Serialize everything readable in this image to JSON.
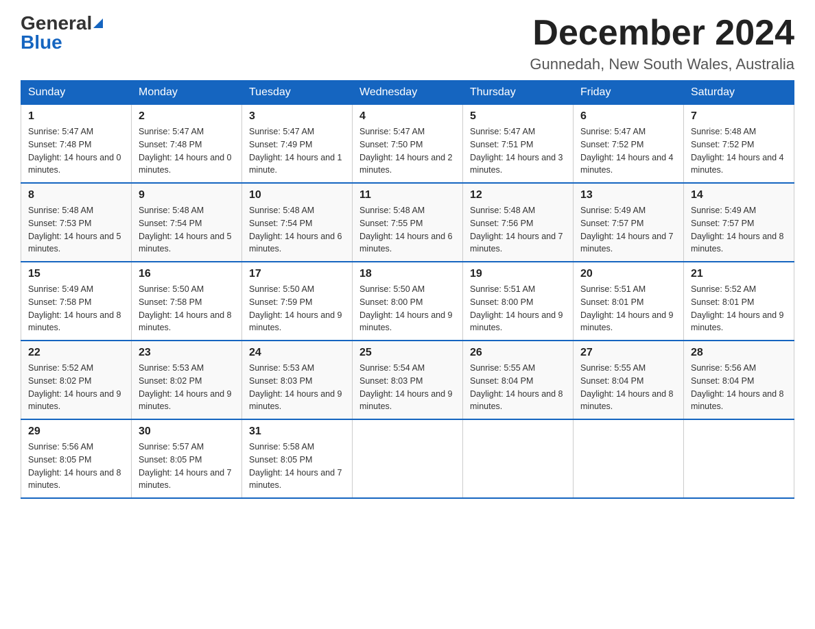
{
  "header": {
    "logo_general": "General",
    "logo_blue": "Blue",
    "month_title": "December 2024",
    "location": "Gunnedah, New South Wales, Australia"
  },
  "weekdays": [
    "Sunday",
    "Monday",
    "Tuesday",
    "Wednesday",
    "Thursday",
    "Friday",
    "Saturday"
  ],
  "weeks": [
    [
      {
        "day": "1",
        "sunrise": "5:47 AM",
        "sunset": "7:48 PM",
        "daylight": "14 hours and 0 minutes."
      },
      {
        "day": "2",
        "sunrise": "5:47 AM",
        "sunset": "7:48 PM",
        "daylight": "14 hours and 0 minutes."
      },
      {
        "day": "3",
        "sunrise": "5:47 AM",
        "sunset": "7:49 PM",
        "daylight": "14 hours and 1 minute."
      },
      {
        "day": "4",
        "sunrise": "5:47 AM",
        "sunset": "7:50 PM",
        "daylight": "14 hours and 2 minutes."
      },
      {
        "day": "5",
        "sunrise": "5:47 AM",
        "sunset": "7:51 PM",
        "daylight": "14 hours and 3 minutes."
      },
      {
        "day": "6",
        "sunrise": "5:47 AM",
        "sunset": "7:52 PM",
        "daylight": "14 hours and 4 minutes."
      },
      {
        "day": "7",
        "sunrise": "5:48 AM",
        "sunset": "7:52 PM",
        "daylight": "14 hours and 4 minutes."
      }
    ],
    [
      {
        "day": "8",
        "sunrise": "5:48 AM",
        "sunset": "7:53 PM",
        "daylight": "14 hours and 5 minutes."
      },
      {
        "day": "9",
        "sunrise": "5:48 AM",
        "sunset": "7:54 PM",
        "daylight": "14 hours and 5 minutes."
      },
      {
        "day": "10",
        "sunrise": "5:48 AM",
        "sunset": "7:54 PM",
        "daylight": "14 hours and 6 minutes."
      },
      {
        "day": "11",
        "sunrise": "5:48 AM",
        "sunset": "7:55 PM",
        "daylight": "14 hours and 6 minutes."
      },
      {
        "day": "12",
        "sunrise": "5:48 AM",
        "sunset": "7:56 PM",
        "daylight": "14 hours and 7 minutes."
      },
      {
        "day": "13",
        "sunrise": "5:49 AM",
        "sunset": "7:57 PM",
        "daylight": "14 hours and 7 minutes."
      },
      {
        "day": "14",
        "sunrise": "5:49 AM",
        "sunset": "7:57 PM",
        "daylight": "14 hours and 8 minutes."
      }
    ],
    [
      {
        "day": "15",
        "sunrise": "5:49 AM",
        "sunset": "7:58 PM",
        "daylight": "14 hours and 8 minutes."
      },
      {
        "day": "16",
        "sunrise": "5:50 AM",
        "sunset": "7:58 PM",
        "daylight": "14 hours and 8 minutes."
      },
      {
        "day": "17",
        "sunrise": "5:50 AM",
        "sunset": "7:59 PM",
        "daylight": "14 hours and 9 minutes."
      },
      {
        "day": "18",
        "sunrise": "5:50 AM",
        "sunset": "8:00 PM",
        "daylight": "14 hours and 9 minutes."
      },
      {
        "day": "19",
        "sunrise": "5:51 AM",
        "sunset": "8:00 PM",
        "daylight": "14 hours and 9 minutes."
      },
      {
        "day": "20",
        "sunrise": "5:51 AM",
        "sunset": "8:01 PM",
        "daylight": "14 hours and 9 minutes."
      },
      {
        "day": "21",
        "sunrise": "5:52 AM",
        "sunset": "8:01 PM",
        "daylight": "14 hours and 9 minutes."
      }
    ],
    [
      {
        "day": "22",
        "sunrise": "5:52 AM",
        "sunset": "8:02 PM",
        "daylight": "14 hours and 9 minutes."
      },
      {
        "day": "23",
        "sunrise": "5:53 AM",
        "sunset": "8:02 PM",
        "daylight": "14 hours and 9 minutes."
      },
      {
        "day": "24",
        "sunrise": "5:53 AM",
        "sunset": "8:03 PM",
        "daylight": "14 hours and 9 minutes."
      },
      {
        "day": "25",
        "sunrise": "5:54 AM",
        "sunset": "8:03 PM",
        "daylight": "14 hours and 9 minutes."
      },
      {
        "day": "26",
        "sunrise": "5:55 AM",
        "sunset": "8:04 PM",
        "daylight": "14 hours and 8 minutes."
      },
      {
        "day": "27",
        "sunrise": "5:55 AM",
        "sunset": "8:04 PM",
        "daylight": "14 hours and 8 minutes."
      },
      {
        "day": "28",
        "sunrise": "5:56 AM",
        "sunset": "8:04 PM",
        "daylight": "14 hours and 8 minutes."
      }
    ],
    [
      {
        "day": "29",
        "sunrise": "5:56 AM",
        "sunset": "8:05 PM",
        "daylight": "14 hours and 8 minutes."
      },
      {
        "day": "30",
        "sunrise": "5:57 AM",
        "sunset": "8:05 PM",
        "daylight": "14 hours and 7 minutes."
      },
      {
        "day": "31",
        "sunrise": "5:58 AM",
        "sunset": "8:05 PM",
        "daylight": "14 hours and 7 minutes."
      },
      null,
      null,
      null,
      null
    ]
  ]
}
